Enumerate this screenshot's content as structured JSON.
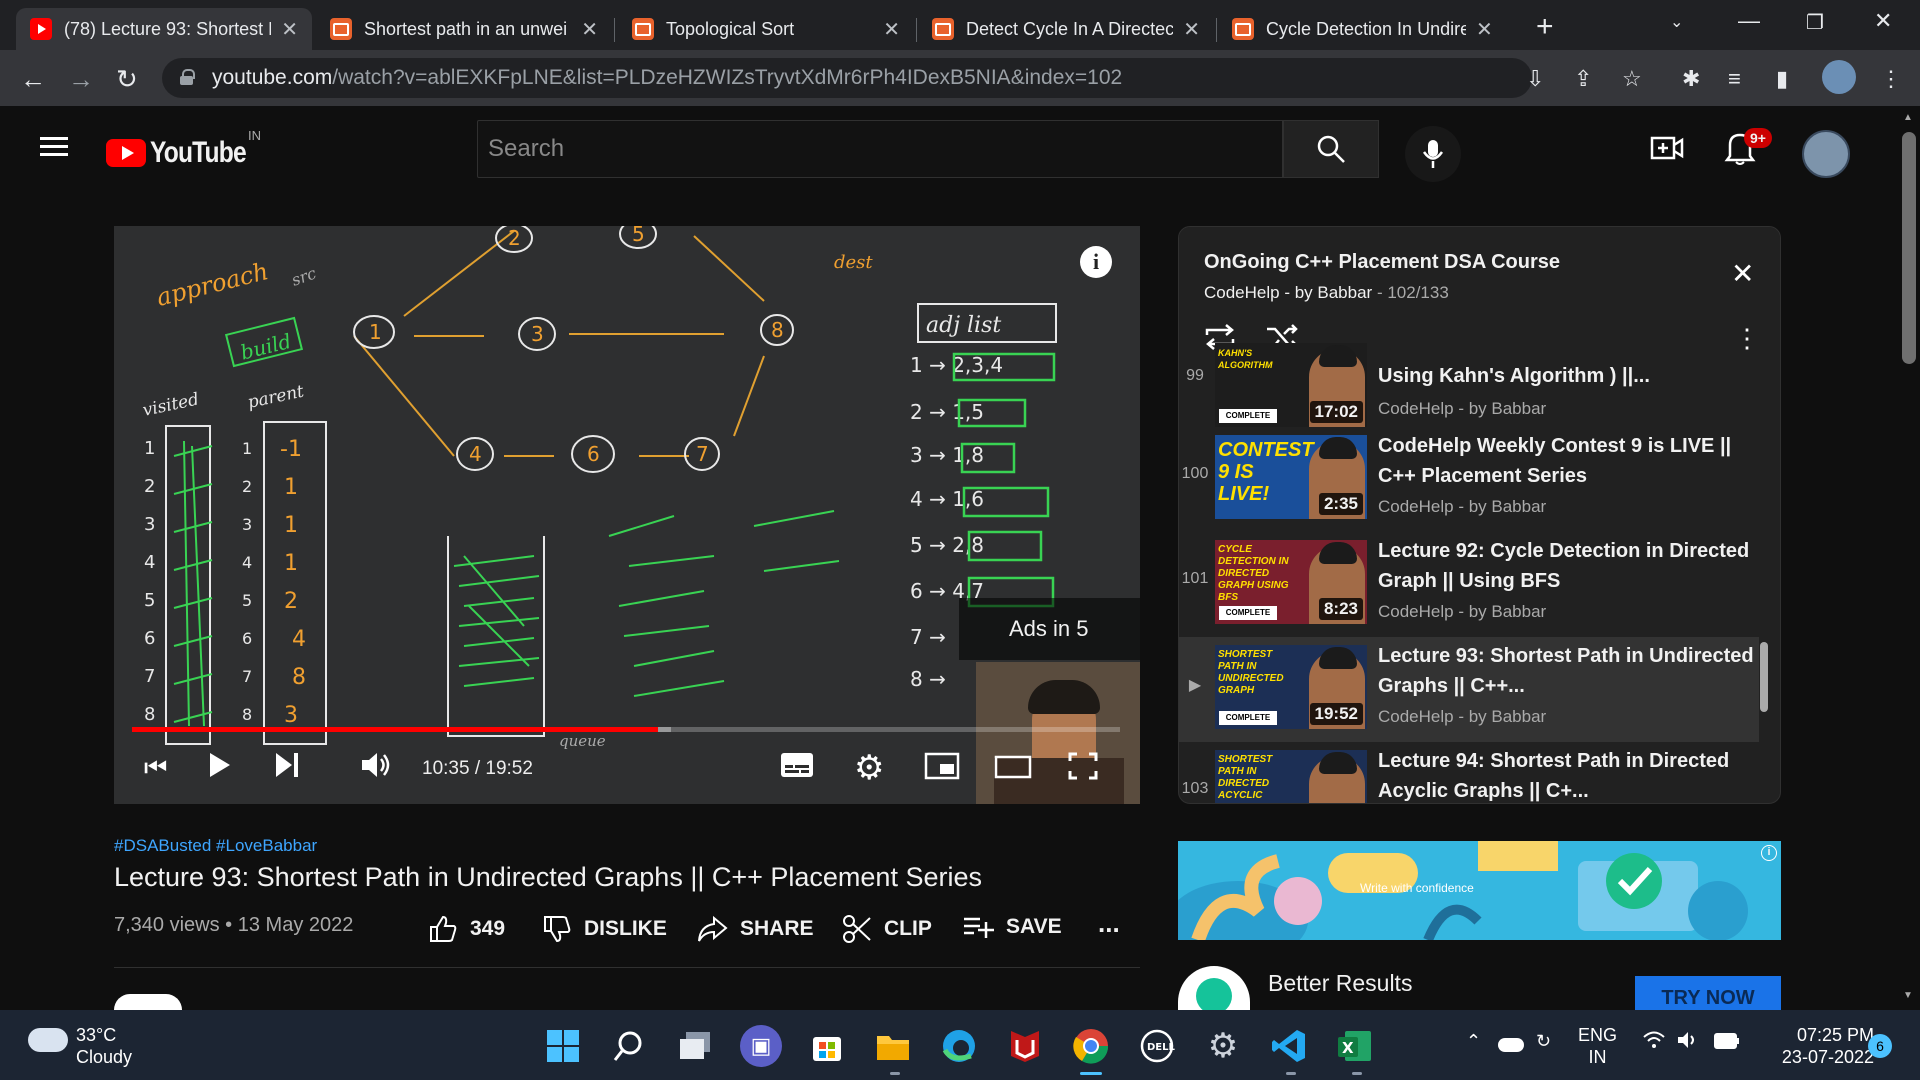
{
  "browser": {
    "tabs": [
      {
        "title": "(78) Lecture 93: Shortest P",
        "icon": "youtube-icon",
        "active": true
      },
      {
        "title": "Shortest path in an unwei",
        "icon": "codehelp-icon"
      },
      {
        "title": "Topological Sort",
        "icon": "codehelp-icon"
      },
      {
        "title": "Detect Cycle In A Directec",
        "icon": "codehelp-icon"
      },
      {
        "title": "Cycle Detection In Undire",
        "icon": "codehelp-icon"
      }
    ],
    "new_tab": "+",
    "url_host": "youtube.com",
    "url_path": "/watch?v=ablEXKFpLNE&list=PLDzeHZWIZsTryvtXdMr6rPh4IDexB5NIA&index=102"
  },
  "youtube": {
    "logo_text": "YouTube",
    "country_code": "IN",
    "search_placeholder": "Search",
    "notification_badge": "9+"
  },
  "player": {
    "info": "i",
    "ads_text": "Ads in 5",
    "time_current": "10:35",
    "time_total": "19:52",
    "time_display": "10:35 / 19:52",
    "played_fraction": 0.5327,
    "loaded_fraction": 0.546,
    "board_labels": {
      "approach": "approach",
      "src": "src",
      "dest": "dest",
      "build": "build",
      "adj_list": "adj list",
      "visited": "visited",
      "parent": "parent",
      "queue": "queue",
      "adj": [
        "1 → 2,3,4",
        "2 → 1,5",
        "3 → 1,8",
        "4 → 1,6",
        "5 → 2,8",
        "6 → 4,7",
        "7 →",
        "8 →"
      ],
      "visited_rows": [
        "1",
        "2",
        "3",
        "4",
        "5",
        "6",
        "7",
        "8"
      ],
      "parent_values": [
        "-1",
        "1",
        "1",
        "1",
        "2",
        "4",
        "8",
        "3"
      ],
      "nodes": [
        "1",
        "2",
        "3",
        "8",
        "4",
        "6",
        "7",
        "5"
      ]
    }
  },
  "video_info": {
    "hashtags": "#DSABusted #LoveBabbar",
    "title": "Lecture 93: Shortest Path in Undirected Graphs || C++ Placement Series",
    "views_date": "7,340 views • 13 May 2022",
    "likes": "349",
    "dislike_label": "DISLIKE",
    "share_label": "SHARE",
    "clip_label": "CLIP",
    "save_label": "SAVE",
    "more": "..."
  },
  "playlist": {
    "title": "OnGoing C++ Placement DSA Course",
    "channel": "CodeHelp - by Babbar",
    "position": "102/133",
    "items": [
      {
        "index": "99",
        "title": "Using Kahn's Algorithm ) ||...",
        "channel": "CodeHelp - by Babbar",
        "duration": "17:02",
        "thumb_text": "KAHN'S ALGORITHM"
      },
      {
        "index": "100",
        "title": "CodeHelp Weekly Contest 9 is LIVE || C++ Placement Series",
        "channel": "CodeHelp - by Babbar",
        "duration": "2:35",
        "thumb_text": "CONTEST 9 IS LIVE!"
      },
      {
        "index": "101",
        "title": "Lecture 92: Cycle Detection in Directed Graph || Using BFS",
        "channel": "CodeHelp - by Babbar",
        "duration": "8:23",
        "thumb_text": "CYCLE DETECTION IN DIRECTED GRAPH USING BFS"
      },
      {
        "index": "▶",
        "title": "Lecture 93: Shortest Path in Undirected Graphs || C++...",
        "channel": "CodeHelp - by Babbar",
        "duration": "19:52",
        "thumb_text": "SHORTEST PATH IN UNDIRECTED GRAPH",
        "current": true
      },
      {
        "index": "103",
        "title": "Lecture 94: Shortest Path in Directed Acyclic Graphs || C+...",
        "channel": "CodeHelp - by Babbar",
        "duration": "",
        "thumb_text": "SHORTEST PATH IN DIRECTED ACYCLIC GRAPH"
      }
    ]
  },
  "ad": {
    "banner_text": "Write with confidence",
    "title": "Better Results",
    "cta": "TRY NOW"
  },
  "taskbar": {
    "weather_temp": "33°C",
    "weather_desc": "Cloudy",
    "lang": "ENG",
    "region": "IN",
    "time": "07:25 PM",
    "date": "23-07-2022",
    "notif_count": "6"
  },
  "colors": {
    "progress": "#ff0000",
    "link": "#3ea6ff",
    "chalk_green": "#39d353",
    "chalk_orange": "#f0a030"
  }
}
